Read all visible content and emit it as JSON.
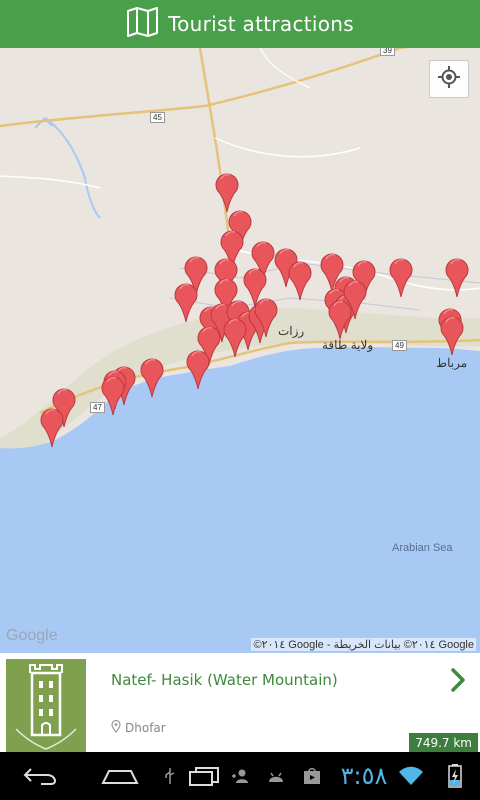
{
  "header": {
    "title": "Tourist attractions"
  },
  "map": {
    "google_logo": "Google",
    "attribution": "©٢٠١٤ Google - ٢٠١٤© بيانات الخريطة Google",
    "sea_label": "Arabian Sea",
    "town_labels": [
      "رزات",
      "ولاية طاقة",
      "مرباط"
    ],
    "road_numbers": [
      "45",
      "39",
      "47",
      "49"
    ],
    "marker_color": "#e8555a"
  },
  "card": {
    "name": "Natef- Hasik (Water Mountain)",
    "location": "Dhofar",
    "distance": "749.7 km"
  },
  "statusbar": {
    "time": "٣:٥٨"
  },
  "colors": {
    "accent": "#4aa04a",
    "sea": "#a9c9f5",
    "land": "#eae6df"
  }
}
